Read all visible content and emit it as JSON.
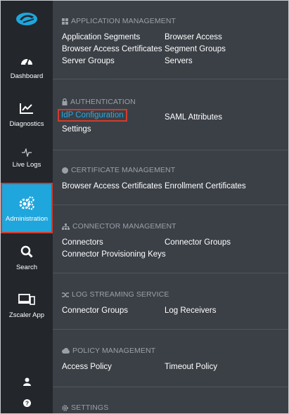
{
  "sidebar": {
    "logo": "zscaler-cloud-logo",
    "items": [
      {
        "label": "Dashboard",
        "icon": "dashboard-gauge-icon"
      },
      {
        "label": "Diagnostics",
        "icon": "line-chart-icon"
      },
      {
        "label": "Live Logs",
        "icon": "pulse-icon"
      },
      {
        "label": "Administration",
        "icon": "gears-icon",
        "active": true
      },
      {
        "label": "Search",
        "icon": "search-icon"
      },
      {
        "label": "Zscaler App",
        "icon": "devices-icon"
      }
    ],
    "bottom_icons": [
      "user-icon",
      "help-icon"
    ]
  },
  "sections": [
    {
      "title": "APPLICATION MANAGEMENT",
      "icon": "grid-icon",
      "links": [
        "Application Segments",
        "Browser Access",
        "Browser Access Certificates",
        "Segment Groups",
        "Server Groups",
        "Servers"
      ]
    },
    {
      "title": "AUTHENTICATION",
      "icon": "lock-icon",
      "links": [
        "IdP Configuration",
        "SAML Attributes",
        "Settings"
      ]
    },
    {
      "title": "CERTIFICATE MANAGEMENT",
      "icon": "badge-icon",
      "links": [
        "Browser Access Certificates",
        "Enrollment Certificates"
      ]
    },
    {
      "title": "CONNECTOR MANAGEMENT",
      "icon": "sitemap-icon",
      "links": [
        "Connectors",
        "Connector Groups",
        "Connector Provisioning Keys"
      ]
    },
    {
      "title": "LOG STREAMING SERVICE",
      "icon": "shuffle-icon",
      "links": [
        "Connector Groups",
        "Log Receivers"
      ]
    },
    {
      "title": "POLICY MANAGEMENT",
      "icon": "cloud-icon",
      "links": [
        "Access Policy",
        "Timeout Policy"
      ]
    },
    {
      "title": "SETTINGS",
      "icon": "gear-icon",
      "links": []
    }
  ],
  "colors": {
    "sidebar_bg": "#23272c",
    "main_bg": "#3b4047",
    "accent": "#1fa6dc",
    "highlight_border": "#d33b2c",
    "link_active": "#27a9e1"
  }
}
